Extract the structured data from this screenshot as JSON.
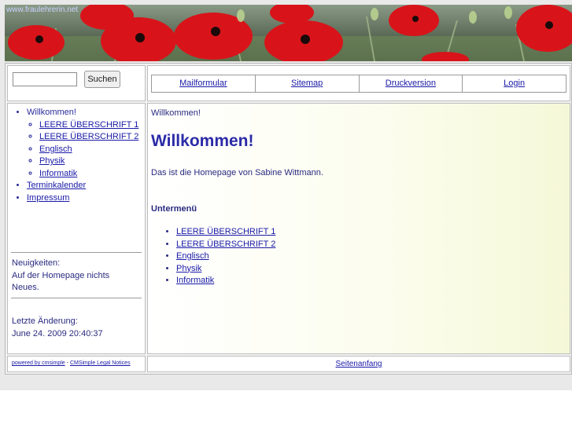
{
  "banner": {
    "domain": "www.fraulehrerin.net"
  },
  "search": {
    "input_value": "",
    "button_label": "Suchen"
  },
  "nav": {
    "items": [
      "Mailformular",
      "Sitemap",
      "Druckversion",
      "Login"
    ]
  },
  "sidebar": {
    "menu": {
      "current": "Willkommen!",
      "sub": [
        "LEERE ÜBERSCHRIFT 1",
        "LEERE ÜBERSCHRIFT 2",
        "Englisch",
        "Physik",
        "Informatik"
      ],
      "top": [
        "Terminkalender",
        "Impressum"
      ]
    },
    "news": {
      "label": "Neuigkeiten:",
      "line1": "Auf der Homepage nichts",
      "line2": "Neues."
    },
    "last_change": {
      "label": "Letzte Änderung:",
      "value": "June 24. 2009 20:40:37"
    }
  },
  "main": {
    "breadcrumb": "Willkommen!",
    "title": "Willkommen!",
    "intro": "Das ist die Homepage von Sabine Wittmann.",
    "submenu_title": "Untermenü",
    "submenu": [
      "LEERE ÜBERSCHRIFT 1",
      "LEERE ÜBERSCHRIFT 2",
      "Englisch",
      "Physik",
      "Informatik"
    ]
  },
  "footer": {
    "powered": "powered by cmsimple",
    "separator": " - ",
    "legal": "CMSimple Legal Notices",
    "top_link": "Seitenanfang"
  },
  "colors": {
    "link": "#1a1aa8",
    "title": "#2b2ba8",
    "poppy": "#d8141a"
  }
}
